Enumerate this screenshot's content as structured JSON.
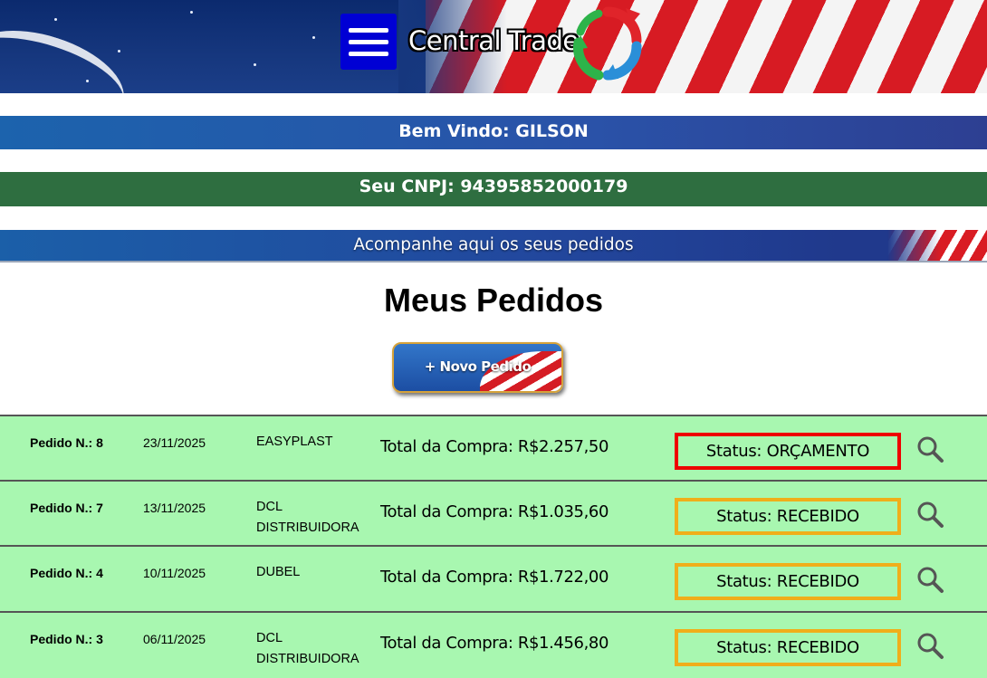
{
  "header": {
    "brand": "Central Trade",
    "menu_icon": "hamburger-menu-icon",
    "logo_icon": "refresh-arrows-logo",
    "colors": {
      "menu_bg": "#0000d4",
      "logo_green": "#2db34a",
      "logo_blue": "#2a8fd8",
      "logo_red": "#e0242a"
    }
  },
  "welcome": {
    "text": "Bem Vindo: GILSON"
  },
  "cnpj": {
    "text": "Seu CNPJ: 94395852000179"
  },
  "tracking": {
    "text": "Acompanhe aqui os seus pedidos"
  },
  "main": {
    "title": "Meus Pedidos",
    "new_order_label": "+ Novo Pedido"
  },
  "orders": [
    {
      "number": "Pedido N.: 8",
      "date": "23/11/2025",
      "vendor": "EASYPLAST",
      "total": "Total da Compra: R$2.257,50",
      "status": "Status:  ORÇAMENTO",
      "status_color": "#ee0000"
    },
    {
      "number": "Pedido N.: 7",
      "date": "13/11/2025",
      "vendor": "DCL DISTRIBUIDORA",
      "total": "Total da Compra: R$1.035,60",
      "status": "Status:  RECEBIDO",
      "status_color": "#f0ae1a"
    },
    {
      "number": "Pedido N.: 4",
      "date": "10/11/2025",
      "vendor": "DUBEL",
      "total": "Total da Compra: R$1.722,00",
      "status": "Status:  RECEBIDO",
      "status_color": "#f0ae1a"
    },
    {
      "number": "Pedido N.: 3",
      "date": "06/11/2025",
      "vendor": "DCL DISTRIBUIDORA",
      "total": "Total da Compra: R$1.456,80",
      "status": "Status:  RECEBIDO",
      "status_color": "#f0ae1a"
    }
  ],
  "row_icon": "search-icon",
  "row_bg": "#a8f7b0"
}
